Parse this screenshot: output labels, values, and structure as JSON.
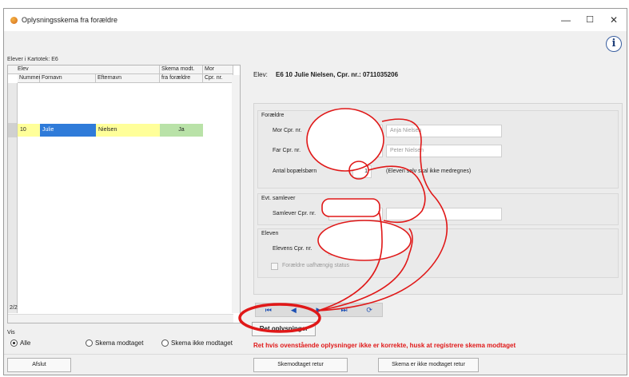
{
  "window": {
    "title": "Oplysningsskema fra forældre",
    "minimize": "—",
    "maximize": "☐",
    "close": "✕",
    "info": "i"
  },
  "left": {
    "kartotek": "Elever i Kartotek: E6",
    "headers": {
      "elev": "Elev",
      "nummer": "Nummer",
      "fornavn": "Fornavn",
      "efternavn": "Efternavn",
      "skema_top": "Skema modt.",
      "skema_bottom": "fra forældre",
      "mor_top": "Mor",
      "mor_bottom": "Cpr. nr."
    },
    "row": {
      "nummer": "10",
      "fornavn": "Julie",
      "efternavn": "Nielsen",
      "skema": "Ja"
    },
    "page": "2/2",
    "vis_label": "Vis",
    "radios": [
      "Alle",
      "Skema modtaget",
      "Skema ikke modtaget"
    ],
    "selected_radio": "Alle"
  },
  "elev": {
    "label": "Elev:",
    "value": "E6   10 Julie Nielsen, Cpr. nr.: 0711035206"
  },
  "foraeldre": {
    "title": "Forældre",
    "mor_label": "Mor   Cpr. nr.",
    "mor_name": "Anja Nielsen",
    "far_label": "Far   Cpr. nr.",
    "far_name": "Peter Nielsen",
    "bopael_label": "Antal bopælsbørn",
    "bopael_value": "1",
    "bopael_note": "(Eleven selv skal ikke medregnes)"
  },
  "samlever": {
    "title": "Evt. samlever",
    "label": "Samlever Cpr. nr."
  },
  "eleven": {
    "title": "Eleven",
    "label": "Elevens Cpr. nr.",
    "checkbox": "Forældre uafhængig status"
  },
  "nav": [
    "⏮",
    "◀",
    "▶",
    "⏭",
    "⟳"
  ],
  "buttons": {
    "ret": "Ret oplysninger",
    "afslut": "Afslut",
    "skema_retur": "Skemodtaget retur",
    "skema_ikke_retur": "Skema er ikke modtaget retur"
  },
  "warning": "Ret hvis ovenstående oplysninger ikke er korrekte, husk at registrere skema modtaget",
  "colors": {
    "highlight_yellow": "#ffff9a",
    "highlight_blue": "#2f7bd9",
    "highlight_green": "#b9e2a8",
    "annotation_red": "#e01818"
  }
}
